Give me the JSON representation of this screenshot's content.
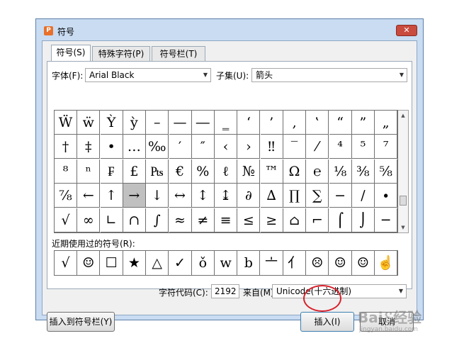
{
  "window": {
    "title": "符号",
    "close_label": "✕"
  },
  "tabs": [
    {
      "label": "符号(S)"
    },
    {
      "label": "特殊字符(P)"
    },
    {
      "label": "符号栏(T)"
    }
  ],
  "font": {
    "label": "字体(F):",
    "value": "Arial Black"
  },
  "subset": {
    "label": "子集(U):",
    "value": "箭头"
  },
  "symbol_grid": [
    [
      "Ẅ",
      "ẅ",
      "Ỳ",
      "ỳ",
      "–",
      "—",
      "―",
      "‗",
      "‘",
      "’",
      "‚",
      "‛",
      "“",
      "”",
      "„"
    ],
    [
      "†",
      "‡",
      "•",
      "…",
      "‰",
      "′",
      "″",
      "‹",
      "›",
      "‼",
      "‾",
      "⁄",
      "⁴",
      "⁵",
      "⁷"
    ],
    [
      "⁸",
      "ⁿ",
      "₣",
      "£",
      "₧",
      "€",
      "%",
      "ℓ",
      "№",
      "™",
      "Ω",
      "℮",
      "⅛",
      "⅜",
      "⅝"
    ],
    [
      "⅞",
      "←",
      "↑",
      "→",
      "↓",
      "↔",
      "↕",
      "↨",
      "∂",
      "∆",
      "∏",
      "∑",
      "−",
      "∕",
      "∙"
    ],
    [
      "√",
      "∞",
      "∟",
      "∩",
      "∫",
      "≈",
      "≠",
      "≡",
      "≤",
      "≥",
      "⌂",
      "⌐",
      "⌠",
      "⌡",
      "─"
    ]
  ],
  "selected_cell": {
    "row": 3,
    "col": 3
  },
  "recent": {
    "label": "近期使用过的符号(R):",
    "symbols": [
      "√",
      "☺",
      "☐",
      "★",
      "△",
      "✓",
      "ǒ",
      "w",
      "b",
      "〦",
      "亻",
      "☹",
      "☺",
      "☺",
      "☝"
    ]
  },
  "char_code": {
    "label": "字符代码(C):",
    "value": "2192"
  },
  "from": {
    "label": "来自(M)",
    "value": "Unicode(十六进制)"
  },
  "buttons": {
    "insert_to_bar": "插入到符号栏(Y)",
    "insert": "插入(I)",
    "cancel": "取消"
  },
  "watermark": {
    "main": "Baiℰ经验",
    "sub": "jingyan.baidu.com"
  },
  "colors": {
    "highlight_circle": "#d8202a",
    "title_bg": "#c9dcf2",
    "close_bg": "#c94a3e"
  }
}
